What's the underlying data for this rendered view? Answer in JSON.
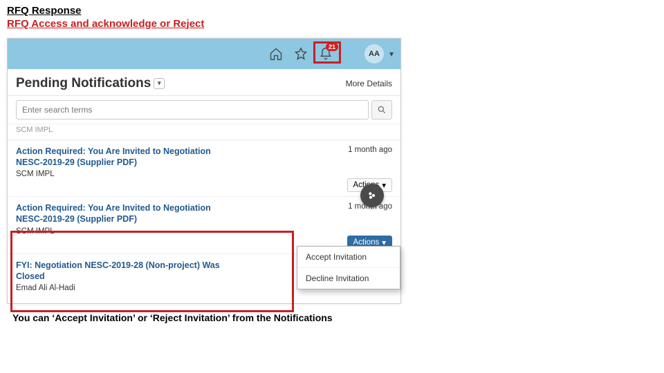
{
  "page": {
    "heading": "RFQ Response",
    "subheading": "RFQ Access and acknowledge or Reject",
    "caption": "You can ‘Accept Invitation’ or ‘Reject Invitation’ from the Notifications"
  },
  "topbar": {
    "notification_count": "21",
    "avatar_initials": "AA"
  },
  "panel": {
    "title": "Pending Notifications",
    "more_details": "More Details"
  },
  "search": {
    "placeholder": "Enter search terms"
  },
  "items": {
    "truncated_top": "SCM IMPL",
    "n0": {
      "title_line1": "Action Required: You Are Invited to Negotiation",
      "title_line2": "NESC-2019-29 (Supplier PDF)",
      "sub": "SCM IMPL",
      "meta": "1 month ago",
      "actions_label": "Actions"
    },
    "n1": {
      "title_line1": "Action Required: You Are Invited to Negotiation",
      "title_line2": "NESC-2019-29 (Supplier PDF)",
      "sub": "SCM IMPL",
      "meta": "1 month ago",
      "actions_label": "Actions"
    },
    "n2": {
      "title_line1": "FYI: Negotiation NESC-2019-28 (Non-project) Was",
      "title_line2": "Closed",
      "sub": "Emad Ali Al-Hadi"
    }
  },
  "popup": {
    "accept": "Accept Invitation",
    "decline": "Decline Invitation"
  }
}
